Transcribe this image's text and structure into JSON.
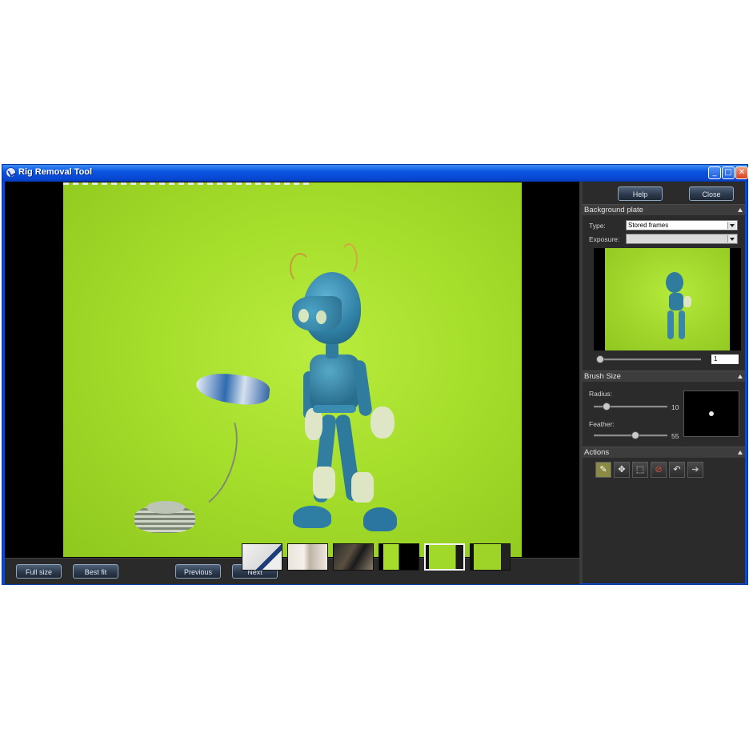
{
  "window": {
    "title": "Rig Removal Tool",
    "controls": {
      "minimize": "_",
      "maximize": "□",
      "close": "✕"
    }
  },
  "bottom_bar": {
    "full_size": "Full size",
    "best_fit": "Best fit",
    "previous": "Previous",
    "next": "Next"
  },
  "thumbnails": [
    {
      "name": "thumb-1",
      "selected": false
    },
    {
      "name": "thumb-2",
      "selected": false
    },
    {
      "name": "thumb-3",
      "selected": false
    },
    {
      "name": "thumb-4",
      "selected": false
    },
    {
      "name": "thumb-5",
      "selected": true
    },
    {
      "name": "thumb-6",
      "selected": false
    }
  ],
  "panel": {
    "help": "Help",
    "close": "Close",
    "background_plate": {
      "title": "Background plate",
      "type_label": "Type:",
      "type_value": "Stored frames",
      "exposure_label": "Exposure:",
      "exposure_value": "",
      "frame_value": "1"
    },
    "brush_size": {
      "title": "Brush Size",
      "radius_label": "Radius:",
      "radius_value": "10",
      "feather_label": "Feather:",
      "feather_value": "55"
    },
    "actions": {
      "title": "Actions",
      "tools": [
        {
          "icon": "paint-brush-icon",
          "glyph": "✎"
        },
        {
          "icon": "move-icon",
          "glyph": "✥"
        },
        {
          "icon": "select-region-icon",
          "glyph": "⬚"
        },
        {
          "icon": "clear-icon",
          "glyph": "⊘"
        },
        {
          "icon": "undo-icon",
          "glyph": "↶"
        },
        {
          "icon": "redo-icon",
          "glyph": "➔"
        }
      ]
    }
  },
  "colors": {
    "accent": "#0a48d8",
    "green_screen": "#a6de2c",
    "panel_bg": "#2b2b2b"
  }
}
